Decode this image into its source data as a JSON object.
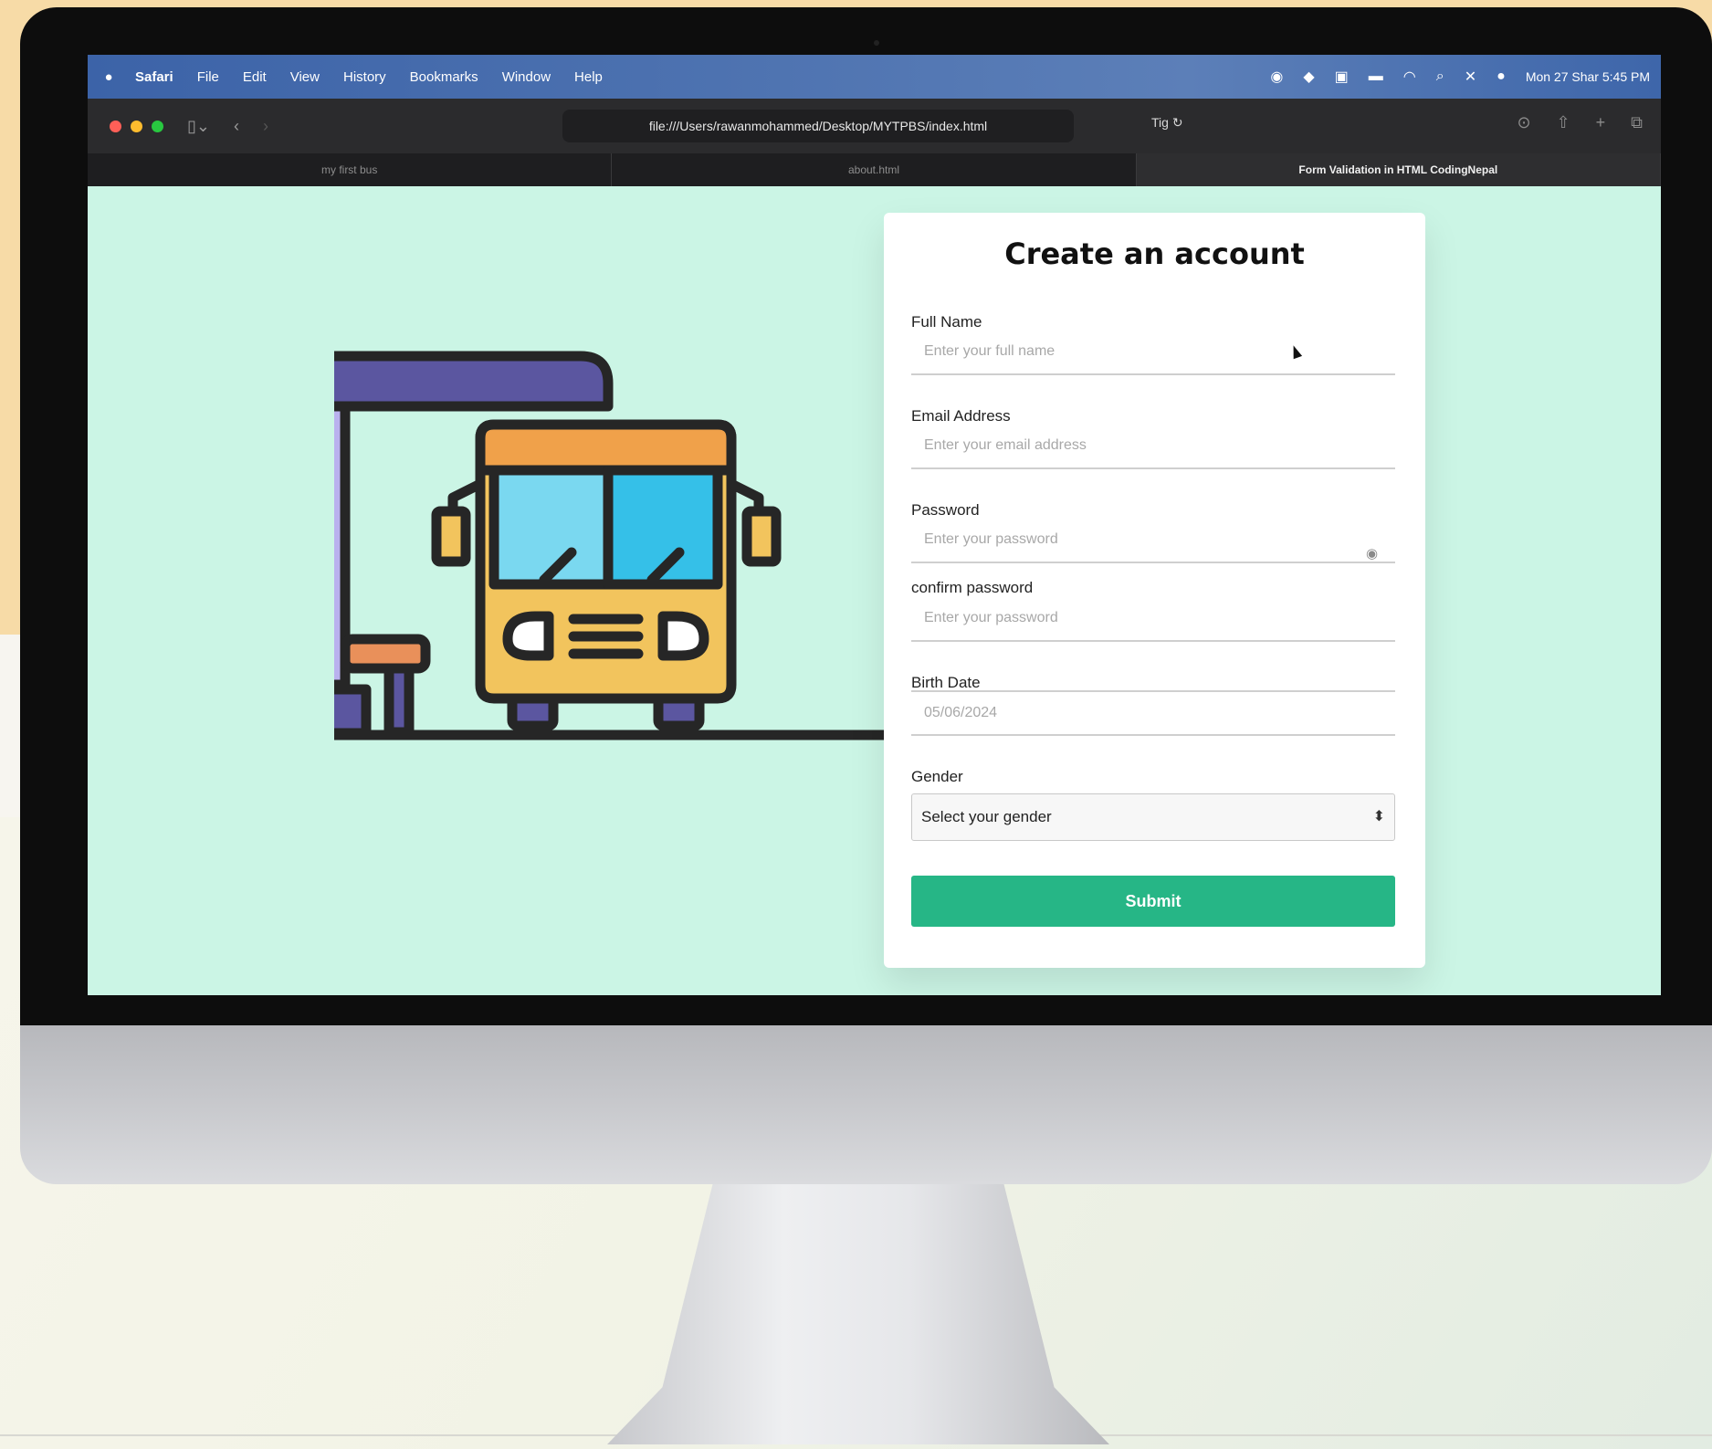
{
  "menubar": {
    "app": "Safari",
    "items": [
      "File",
      "Edit",
      "View",
      "History",
      "Bookmarks",
      "Window",
      "Help"
    ],
    "clock": "Mon 27 Shar 5:45 PM"
  },
  "browser": {
    "url": "file:///Users/rawanmohammed/Desktop/MYTPBS/index.html",
    "url_extra": "Tig",
    "tabs": [
      {
        "label": "my first bus"
      },
      {
        "label": "about.html"
      },
      {
        "label": "Form Validation in HTML  CodingNepal"
      }
    ]
  },
  "form": {
    "title": "Create an account",
    "full_name": {
      "label": "Full Name",
      "placeholder": "Enter your full name"
    },
    "email": {
      "label": "Email Address",
      "placeholder": "Enter your email address"
    },
    "password": {
      "label": "Password",
      "placeholder": "Enter your password"
    },
    "confirm": {
      "label": "confirm password",
      "placeholder": "Enter your password"
    },
    "birth_date": {
      "label": "Birth Date",
      "value": "05/06/2024"
    },
    "gender": {
      "label": "Gender",
      "selected": "Select your gender"
    },
    "submit_label": "Submit"
  },
  "colors": {
    "page_bg": "#cbf5e5",
    "submit": "#26b686",
    "bus_roof": "#5b56a0",
    "bus_front": "#f2c45d",
    "bus_top": "#f0a14a",
    "window": "#35c0e8"
  }
}
